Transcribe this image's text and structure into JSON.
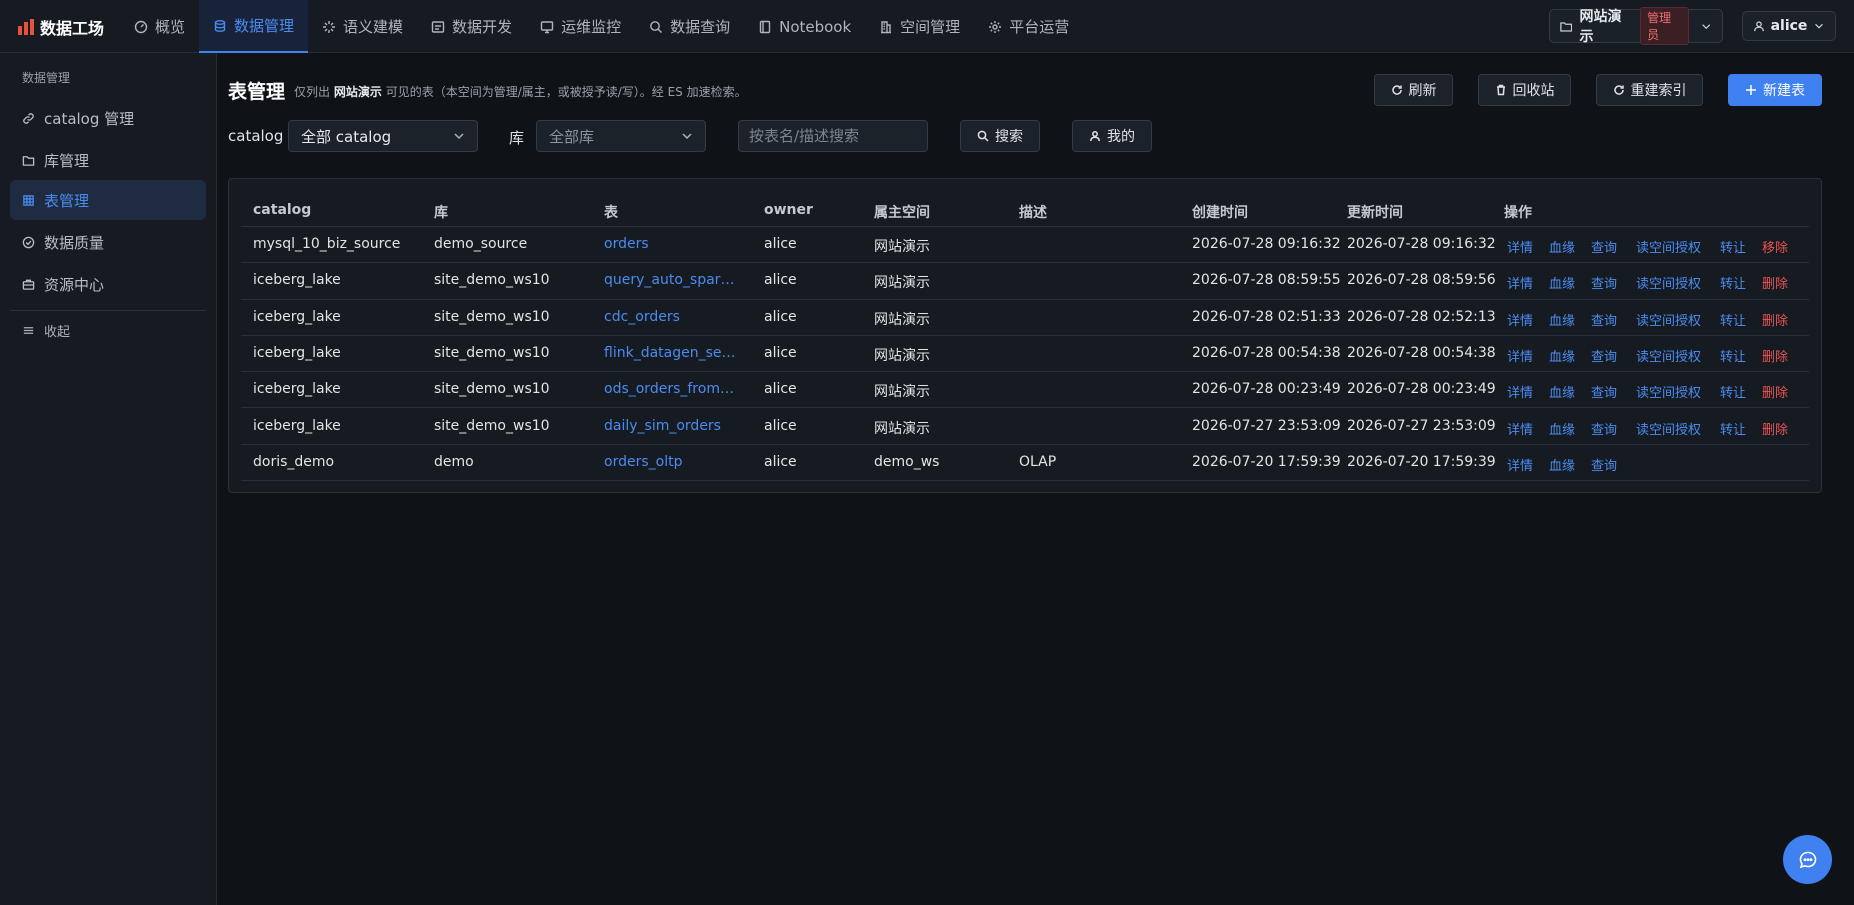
{
  "brand": {
    "title": "数据工场"
  },
  "nav": [
    {
      "label": "概览",
      "icon": "dashboard-icon"
    },
    {
      "label": "数据管理",
      "icon": "database-icon"
    },
    {
      "label": "语义建模",
      "icon": "sparkle-icon"
    },
    {
      "label": "数据开发",
      "icon": "code-icon"
    },
    {
      "label": "运维监控",
      "icon": "monitor-icon"
    },
    {
      "label": "数据查询",
      "icon": "search-icon"
    },
    {
      "label": "Notebook",
      "icon": "notebook-icon"
    },
    {
      "label": "空间管理",
      "icon": "building-icon"
    },
    {
      "label": "平台运营",
      "icon": "gear-icon"
    }
  ],
  "workspace": {
    "name": "网站演示",
    "role": "管理员"
  },
  "user": {
    "name": "alice"
  },
  "sidebar": {
    "title": "数据管理",
    "items": [
      {
        "label": "catalog 管理",
        "icon": "link-icon"
      },
      {
        "label": "库管理",
        "icon": "folder-icon"
      },
      {
        "label": "表管理",
        "icon": "grid-icon"
      },
      {
        "label": "数据质量",
        "icon": "check-circle-icon"
      },
      {
        "label": "资源中心",
        "icon": "briefcase-icon"
      }
    ],
    "collapse_label": "收起"
  },
  "page": {
    "title": "表管理",
    "subtitle_prefix": "仅列出",
    "subtitle_workspace": "网站演示",
    "subtitle_suffix": "可见的表（本空间为管理/属主，或被授予读/写）。经 ES 加速检索。"
  },
  "toolbar": {
    "refresh": "刷新",
    "recycle": "回收站",
    "reindex": "重建索引",
    "create": "新建表"
  },
  "filters": {
    "catalog_label": "catalog",
    "catalog_value": "全部 catalog",
    "db_label": "库",
    "db_value": "全部库",
    "search_placeholder": "按表名/描述搜索",
    "search_button": "搜索",
    "mine_button": "我的"
  },
  "table": {
    "columns": [
      "catalog",
      "库",
      "表",
      "owner",
      "属主空间",
      "描述",
      "创建时间",
      "更新时间",
      "操作"
    ],
    "rows": [
      {
        "catalog": "mysql_10_biz_source",
        "db": "demo_source",
        "table": "orders",
        "owner": "alice",
        "space": "网站演示",
        "desc": "",
        "created": "2026-07-28 09:16:32",
        "updated": "2026-07-28 09:16:32",
        "actions": [
          "详情",
          "血缘",
          "查询",
          "读空间授权",
          "转让",
          "移除"
        ]
      },
      {
        "catalog": "iceberg_lake",
        "db": "site_demo_ws10",
        "table": "query_auto_spark_iceberg",
        "owner": "alice",
        "space": "网站演示",
        "desc": "",
        "created": "2026-07-28 08:59:55",
        "updated": "2026-07-28 08:59:56",
        "actions": [
          "详情",
          "血缘",
          "查询",
          "读空间授权",
          "转让",
          "删除"
        ]
      },
      {
        "catalog": "iceberg_lake",
        "db": "site_demo_ws10",
        "table": "cdc_orders",
        "owner": "alice",
        "space": "网站演示",
        "desc": "",
        "created": "2026-07-28 02:51:33",
        "updated": "2026-07-28 02:52:13",
        "actions": [
          "详情",
          "血缘",
          "查询",
          "读空间授权",
          "转让",
          "删除"
        ]
      },
      {
        "catalog": "iceberg_lake",
        "db": "site_demo_ws10",
        "table": "flink_datagen_sensor",
        "owner": "alice",
        "space": "网站演示",
        "desc": "",
        "created": "2026-07-28 00:54:38",
        "updated": "2026-07-28 00:54:38",
        "actions": [
          "详情",
          "血缘",
          "查询",
          "读空间授权",
          "转让",
          "删除"
        ]
      },
      {
        "catalog": "iceberg_lake",
        "db": "site_demo_ws10",
        "table": "ods_orders_from_mysql",
        "owner": "alice",
        "space": "网站演示",
        "desc": "",
        "created": "2026-07-28 00:23:49",
        "updated": "2026-07-28 00:23:49",
        "actions": [
          "详情",
          "血缘",
          "查询",
          "读空间授权",
          "转让",
          "删除"
        ]
      },
      {
        "catalog": "iceberg_lake",
        "db": "site_demo_ws10",
        "table": "daily_sim_orders",
        "owner": "alice",
        "space": "网站演示",
        "desc": "",
        "created": "2026-07-27 23:53:09",
        "updated": "2026-07-27 23:53:09",
        "actions": [
          "详情",
          "血缘",
          "查询",
          "读空间授权",
          "转让",
          "删除"
        ]
      },
      {
        "catalog": "doris_demo",
        "db": "demo",
        "table": "orders_oltp",
        "owner": "alice",
        "space": "demo_ws",
        "desc": "OLAP",
        "created": "2026-07-20 17:59:39",
        "updated": "2026-07-20 17:59:39",
        "actions": [
          "详情",
          "血缘",
          "查询"
        ]
      }
    ]
  },
  "colors": {
    "accent": "#3f81f0",
    "danger": "#e85454",
    "background": "#0f1318",
    "panel": "#161b22"
  }
}
